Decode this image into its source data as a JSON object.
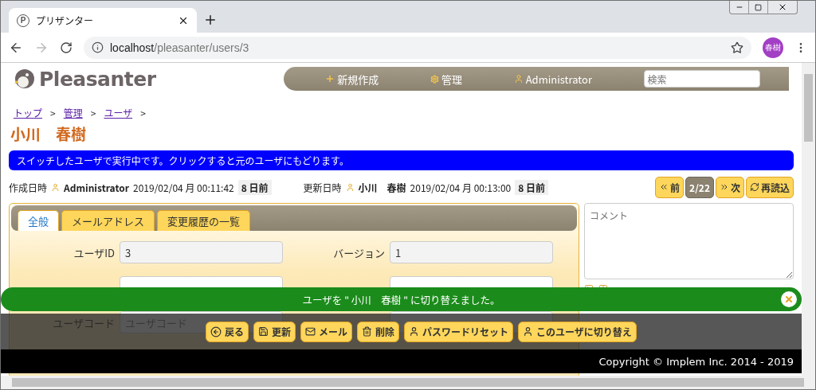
{
  "browser": {
    "tab": {
      "favicon": "P",
      "title": "プリザンター"
    },
    "url": {
      "host": "localhost",
      "path": "/pleasanter/users/3"
    },
    "profile": "春樹"
  },
  "header": {
    "logo": "Pleasanter",
    "nav": [
      {
        "label": "新規作成",
        "kind": "new"
      },
      {
        "label": "管理",
        "kind": "settings"
      },
      {
        "label": "Administrator",
        "kind": "user"
      }
    ],
    "search": {
      "placeholder": "検索"
    }
  },
  "breadcrumb": {
    "separator": ">",
    "items": [
      "トップ",
      "管理",
      "ユーザ"
    ]
  },
  "title": "小川　春樹",
  "banner": "スイッチしたユーザで実行中です。クリックすると元のユーザにもどります。",
  "meta": [
    {
      "label": "作成日時",
      "user": "Administrator",
      "date": "2019/02/04 月 00:11:42",
      "ago": "8 日前"
    },
    {
      "label": "更新日時",
      "user": "小川　春樹",
      "date": "2019/02/04 月 00:13:00",
      "ago": "8 日前"
    }
  ],
  "pager": [
    {
      "label": "前",
      "kind": "prev"
    },
    {
      "label": "2/22",
      "kind": "count"
    },
    {
      "label": "次",
      "kind": "next"
    },
    {
      "label": "再読込",
      "kind": "reload"
    }
  ],
  "tabs": [
    {
      "label": "全般",
      "selected": true
    },
    {
      "label": "メールアドレス",
      "selected": false
    },
    {
      "label": "変更履歴の一覧",
      "selected": false
    }
  ],
  "form": {
    "fields": [
      {
        "label": "ユーザID",
        "value": "3",
        "readonly": true
      },
      {
        "label": "バージョン",
        "value": "1",
        "readonly": true
      },
      {
        "readonly": false
      },
      {
        "readonly": false
      },
      {
        "label": "ユーザコード",
        "placeholder": "ユーザコード",
        "readonly": false
      },
      {
        "readonly": false
      }
    ]
  },
  "comment": {
    "placeholder": "コメント"
  },
  "toast": {
    "message": "ユーザを \" 小川　春樹 \" に切り替えました。"
  },
  "toolbar": [
    {
      "label": "戻る",
      "kind": "back"
    },
    {
      "label": "更新",
      "kind": "save"
    },
    {
      "label": "メール",
      "kind": "mail"
    },
    {
      "label": "削除",
      "kind": "delete"
    },
    {
      "label": "パスワードリセット",
      "kind": "user"
    },
    {
      "label": "このユーザに切り替え",
      "kind": "user"
    }
  ],
  "footer": "Copyright © Implem Inc. 2014 - 2019"
}
